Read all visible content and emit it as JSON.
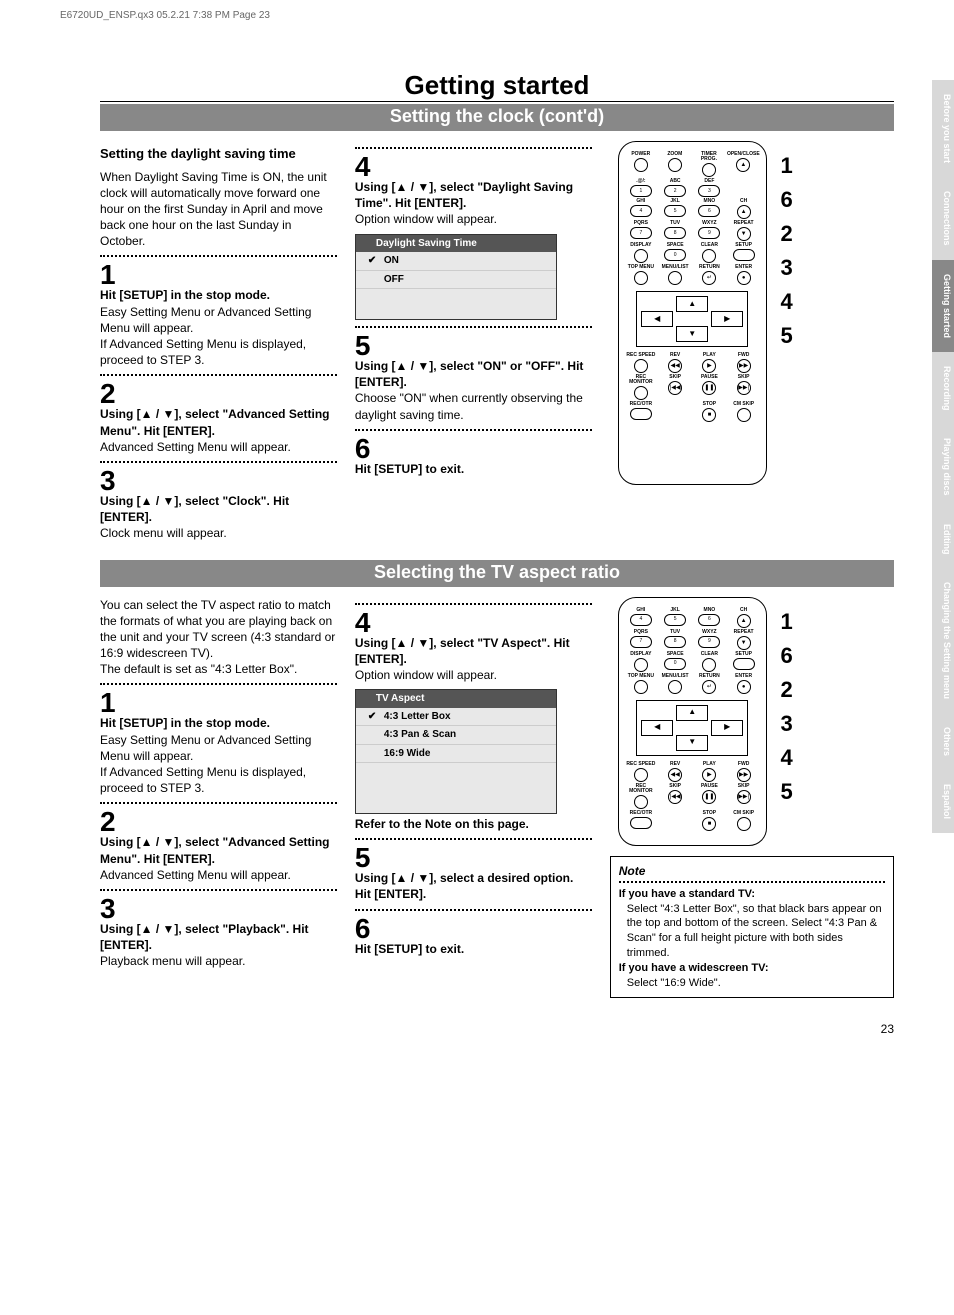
{
  "meta": {
    "header": "E6720UD_ENSP.qx3   05.2.21 7:38 PM   Page 23",
    "page_number": "23"
  },
  "tabs": {
    "t1": "Before you start",
    "t2": "Connections",
    "t3": "Getting started",
    "t4": "Recording",
    "t5": "Playing discs",
    "t6": "Editing",
    "t7": "Changing the Setting menu",
    "t8": "Others",
    "t9": "Español"
  },
  "section1": {
    "title": "Getting started",
    "subbar": "Setting the clock (cont'd)",
    "col1": {
      "head": "Setting the daylight saving time",
      "intro": "When Daylight Saving Time is ON, the unit clock will automatically move forward one hour on the first Sunday in April and move back one hour on the last Sunday in October.",
      "s1n": "1",
      "s1t": "Hit [SETUP] in the stop mode.",
      "s1x": "Easy Setting Menu or Advanced Setting Menu will appear.\nIf Advanced Setting Menu is displayed, proceed to STEP 3.",
      "s2n": "2",
      "s2t": "Using [▲ / ▼], select \"Advanced Setting Menu\". Hit [ENTER].",
      "s2x": "Advanced Setting Menu will appear.",
      "s3n": "3",
      "s3t": "Using [▲ / ▼], select \"Clock\". Hit [ENTER].",
      "s3x": "Clock menu will appear."
    },
    "col2": {
      "s4n": "4",
      "s4t": "Using [▲ / ▼], select \"Daylight Saving Time\". Hit [ENTER].",
      "s4x": "Option window will appear.",
      "menu_title": "Daylight Saving Time",
      "menu_opt1": "ON",
      "menu_opt2": "OFF",
      "s5n": "5",
      "s5t": "Using [▲ / ▼], select \"ON\" or \"OFF\". Hit [ENTER].",
      "s5x": "Choose \"ON\" when currently observing the daylight saving time.",
      "s6n": "6",
      "s6t": "Hit [SETUP] to exit."
    },
    "sidenums": {
      "n1": "1",
      "n2": "6",
      "n3": "2",
      "n4": "3",
      "n5": "4",
      "n6": "5"
    }
  },
  "section2": {
    "subbar": "Selecting the TV aspect ratio",
    "col1": {
      "intro": "You can select the TV aspect ratio to match the formats of what you are playing back on the unit and your TV screen (4:3 standard or 16:9 widescreen TV).\nThe default is set as \"4:3 Letter Box\".",
      "s1n": "1",
      "s1t": "Hit [SETUP] in the stop mode.",
      "s1x": "Easy Setting Menu or Advanced Setting Menu will appear.\nIf Advanced Setting Menu is displayed, proceed to STEP 3.",
      "s2n": "2",
      "s2t": "Using [▲ / ▼], select \"Advanced Setting Menu\". Hit [ENTER].",
      "s2x": "Advanced Setting Menu will appear.",
      "s3n": "3",
      "s3t": "Using [▲ / ▼], select \"Playback\". Hit [ENTER].",
      "s3x": "Playback menu will appear."
    },
    "col2": {
      "s4n": "4",
      "s4t": "Using [▲ / ▼], select \"TV Aspect\". Hit [ENTER].",
      "s4x": "Option window will appear.",
      "menu_title": "TV Aspect",
      "menu_opt1": "4:3 Letter Box",
      "menu_opt2": "4:3 Pan & Scan",
      "menu_opt3": "16:9 Wide",
      "refer": "Refer to the Note on this page.",
      "s5n": "5",
      "s5t": "Using [▲ / ▼], select a desired option. Hit [ENTER].",
      "s6n": "6",
      "s6t": "Hit [SETUP] to exit."
    },
    "note": {
      "head": "Note",
      "l1": "If you have a standard TV:",
      "l1x": "Select \"4:3 Letter Box\", so that black bars appear on the top and bottom of the screen. Select \"4:3 Pan & Scan\" for a full height picture with both sides trimmed.",
      "l2": "If you have a widescreen TV:",
      "l2x": "Select \"16:9 Wide\"."
    },
    "sidenums": {
      "n1": "1",
      "n2": "6",
      "n3": "2",
      "n4": "3",
      "n5": "4",
      "n6": "5"
    }
  },
  "remote": {
    "power": "POWER",
    "openclose": "OPEN/CLOSE",
    "zoom": "ZOOM",
    "timer": "TIMER PROG.",
    "at": ".@/:",
    "abc": "ABC",
    "def": "DEF",
    "ghi": "GHI",
    "jkl": "JKL",
    "mno": "MNO",
    "ch": "CH",
    "pqrs": "PQRS",
    "tuv": "TUV",
    "wxyz": "WXYZ",
    "repeat": "REPEAT",
    "display": "DISPLAY",
    "space": "SPACE",
    "clear": "CLEAR",
    "setup": "SETUP",
    "topmenu": "TOP MENU",
    "menulist": "MENU/LIST",
    "return": "RETURN",
    "enter": "ENTER",
    "recspeed": "REC SPEED",
    "rev": "REV",
    "play": "PLAY",
    "fwd": "FWD",
    "recmon": "REC MONITOR",
    "skip": "SKIP",
    "pause": "PAUSE",
    "skip2": "SKIP",
    "recotr": "REC/OTR",
    "stop": "STOP",
    "cmskip": "CM SKIP",
    "n1": "1",
    "n2": "2",
    "n3": "3",
    "n4": "4",
    "n5": "5",
    "n6": "6",
    "n7": "7",
    "n8": "8",
    "n9": "9",
    "n0": "0",
    "eject": "▲",
    "chup": "▲",
    "chdn": "▼",
    "ret": "↵",
    "ent": "●",
    "prev": "◀◀",
    "pl": "▶",
    "ff": "▶▶",
    "sb": "|◀◀",
    "pa": "❚❚",
    "sf": "▶▶|",
    "st": "■"
  }
}
